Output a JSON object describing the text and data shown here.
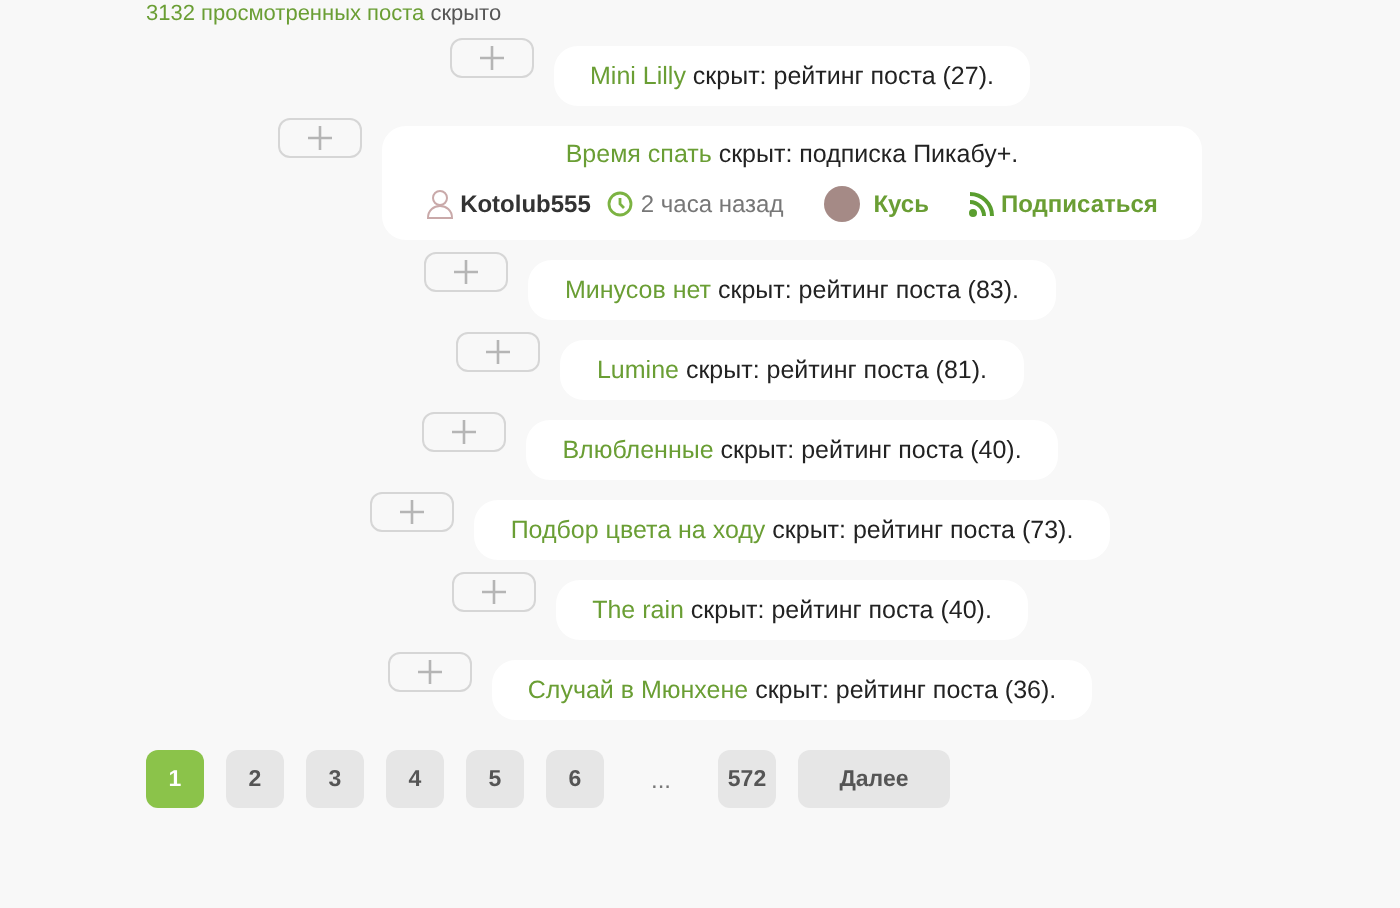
{
  "summary": {
    "count_link": "3132 просмотренных поста",
    "text": "скрыто"
  },
  "hidden_posts": [
    {
      "kind": "simple",
      "title": "Mini Lilly",
      "reason": "скрыт: рейтинг поста (27)."
    },
    {
      "kind": "detailed",
      "title": "Время спать",
      "reason": "скрыт: подписка Пикабу+.",
      "author": "Kotolub555",
      "time": "2 часа назад",
      "community": "Кусь",
      "subscribe": "Подписаться"
    },
    {
      "kind": "simple",
      "title": "Минусов нет",
      "reason": "скрыт: рейтинг поста (83)."
    },
    {
      "kind": "simple",
      "title": "Lumine",
      "reason": "скрыт: рейтинг поста (81)."
    },
    {
      "kind": "simple",
      "title": "Влюбленные",
      "reason": "скрыт: рейтинг поста (40)."
    },
    {
      "kind": "simple",
      "title": "Подбор цвета на ходу",
      "reason": "скрыт: рейтинг поста (73)."
    },
    {
      "kind": "simple",
      "title": "The rain",
      "reason": "скрыт: рейтинг поста (40)."
    },
    {
      "kind": "simple",
      "title": "Случай в Мюнхене",
      "reason": "скрыт: рейтинг поста (36)."
    }
  ],
  "pagination": {
    "pages": [
      {
        "label": "1",
        "selected": true
      },
      {
        "label": "2",
        "selected": false
      },
      {
        "label": "3",
        "selected": false
      },
      {
        "label": "4",
        "selected": false
      },
      {
        "label": "5",
        "selected": false
      },
      {
        "label": "6",
        "selected": false
      }
    ],
    "ellipsis": "...",
    "last": "572",
    "next": "Далее"
  }
}
